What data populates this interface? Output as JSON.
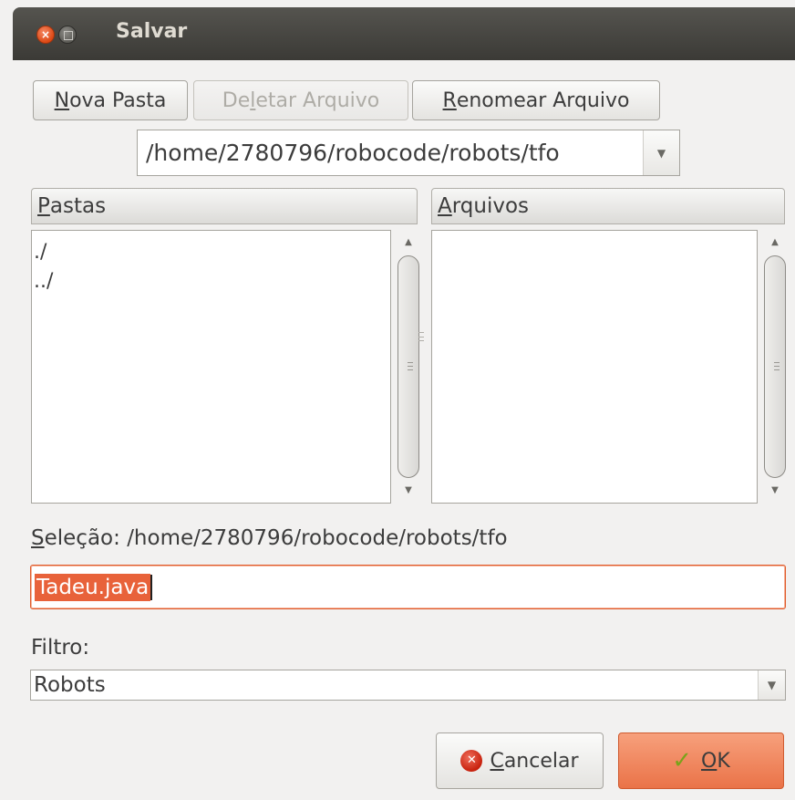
{
  "window": {
    "title": "Salvar"
  },
  "toolbar": {
    "new_folder": {
      "mnemonic": "N",
      "rest": "ova Pasta"
    },
    "delete_file": {
      "before": "De",
      "mnemonic": "l",
      "rest": "etar Arquivo"
    },
    "rename_file": {
      "mnemonic": "R",
      "rest": "enomear Arquivo"
    }
  },
  "path_combo": {
    "value": "/home/2780796/robocode/robots/tfo"
  },
  "folders": {
    "header_mnemonic": "P",
    "header_rest": "astas",
    "items": [
      "./",
      "../"
    ]
  },
  "files": {
    "header_mnemonic": "A",
    "header_rest": "rquivos",
    "items": []
  },
  "selection": {
    "mnemonic": "S",
    "label_rest": "eleção:",
    "path": "/home/2780796/robocode/robots/tfo"
  },
  "filename_input": {
    "value": "Tadeu.java"
  },
  "filter": {
    "label": "Filtro:",
    "value": "Robots"
  },
  "buttons": {
    "cancel": {
      "mnemonic": "C",
      "rest": "ancelar"
    },
    "ok": {
      "mnemonic": "O",
      "rest": "K"
    }
  },
  "colors": {
    "accent": "#e8623a",
    "titlebar": "#3c3b37",
    "background": "#f2f1f0"
  }
}
